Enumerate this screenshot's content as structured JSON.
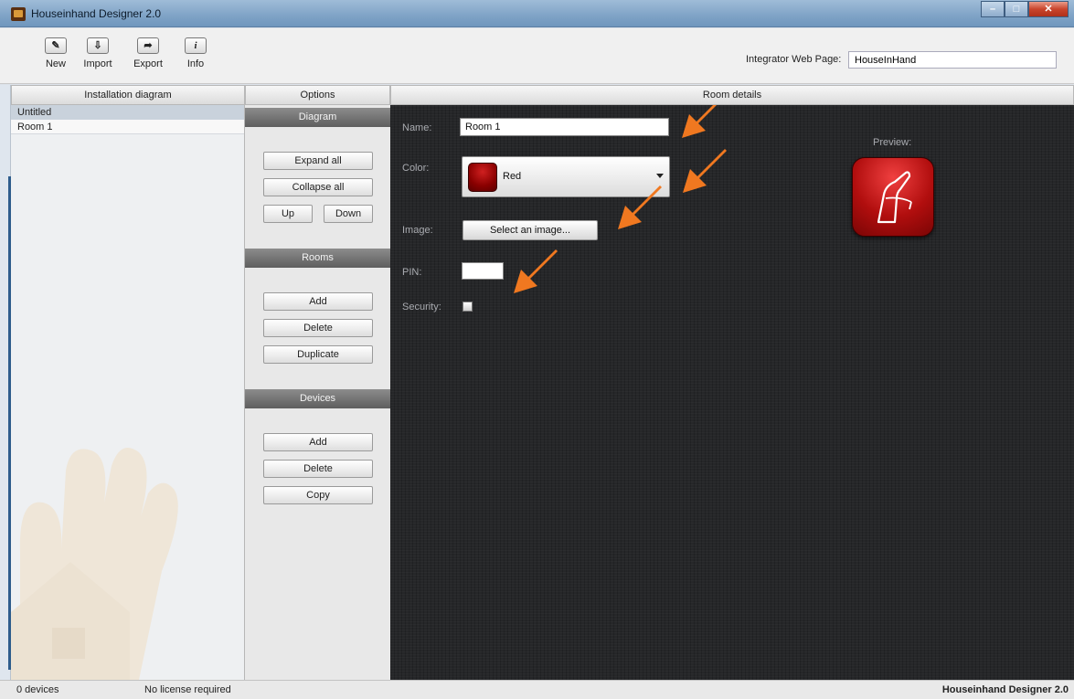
{
  "window": {
    "title": "Houseinhand Designer 2.0",
    "controls": [
      "minimize",
      "maximize",
      "close"
    ]
  },
  "toolbar": {
    "buttons": [
      {
        "label": "New",
        "icon": "new-icon"
      },
      {
        "label": "Import",
        "icon": "import-icon"
      },
      {
        "label": "Export",
        "icon": "export-icon"
      },
      {
        "label": "Info",
        "icon": "info-icon"
      }
    ],
    "integrator_label": "Integrator Web Page:",
    "integrator_value": "HouseInHand"
  },
  "panels": {
    "installation_title": "Installation diagram",
    "options_title": "Options",
    "details_title": "Room details"
  },
  "tree": {
    "items": [
      "Untitled",
      "Room 1"
    ],
    "selected": "Room 1"
  },
  "options": {
    "diagram": {
      "title": "Diagram",
      "expand": "Expand all",
      "collapse": "Collapse all",
      "up": "Up",
      "down": "Down"
    },
    "rooms": {
      "title": "Rooms",
      "add": "Add",
      "delete": "Delete",
      "duplicate": "Duplicate"
    },
    "devices": {
      "title": "Devices",
      "add": "Add",
      "delete": "Delete",
      "copy": "Copy"
    }
  },
  "room_details": {
    "name_label": "Name:",
    "name_value": "Room 1",
    "color_label": "Color:",
    "color_value": "Red",
    "color_hex": "#9b0a0a",
    "image_label": "Image:",
    "image_button": "Select an image...",
    "pin_label": "PIN:",
    "security_label": "Security:",
    "security_checked": false,
    "preview_label": "Preview:",
    "preview_icon": "faucet-icon"
  },
  "annotation_color": "#f07820",
  "status": {
    "devices": "0 devices",
    "license": "No license required",
    "app": "Houseinhand Designer 2.0"
  }
}
